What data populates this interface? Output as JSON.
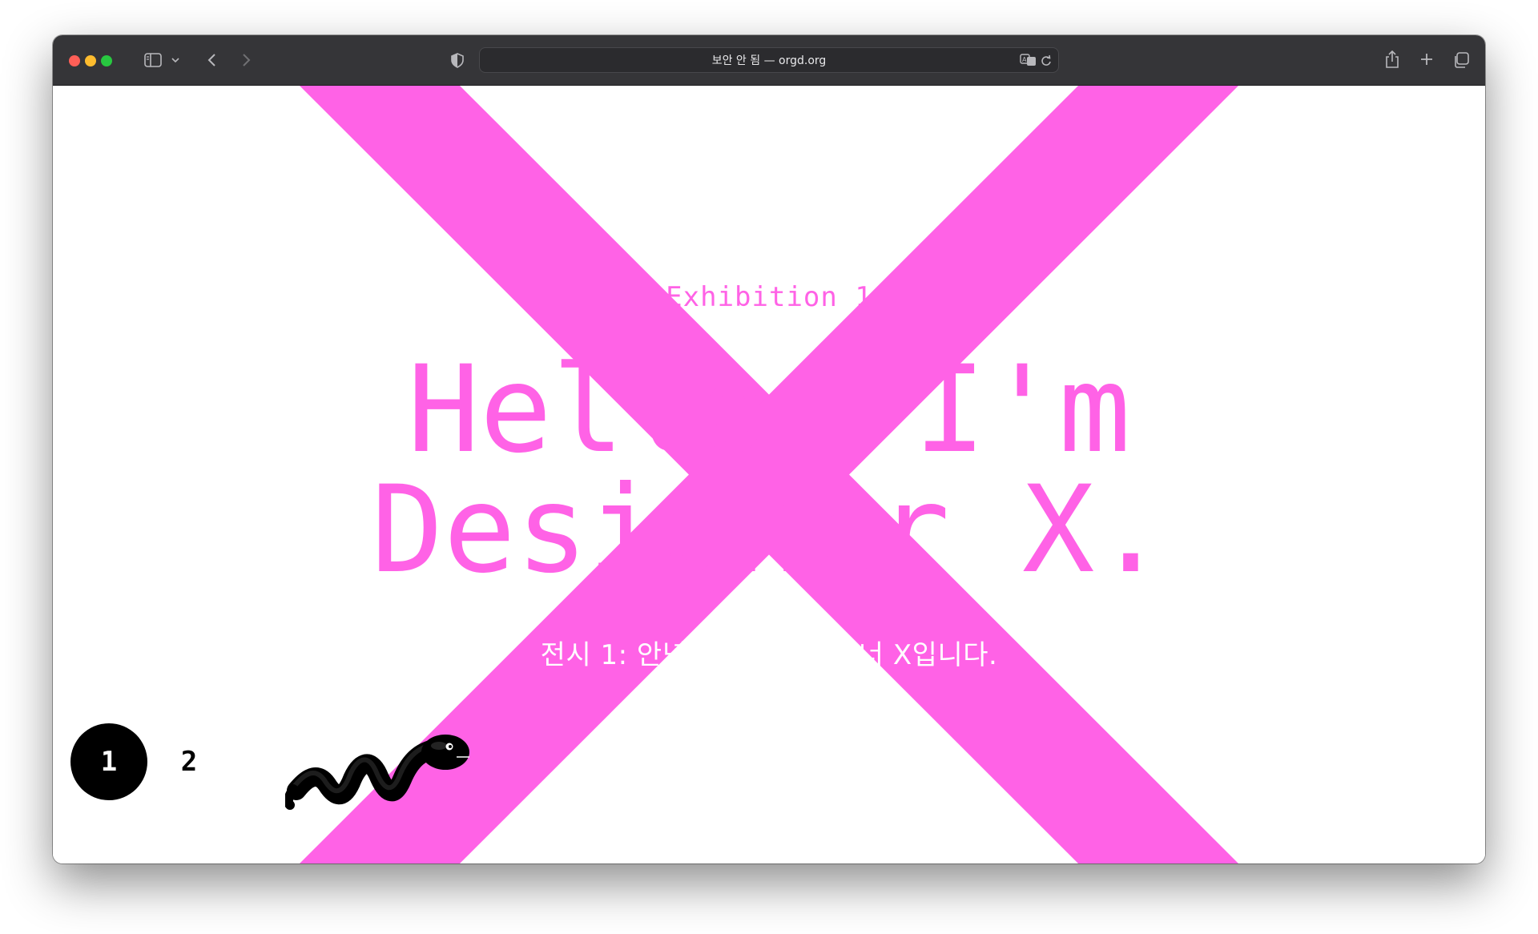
{
  "browser": {
    "url_display": "보안 안 됨 — orgd.org",
    "traffic_lights": {
      "close": "#ff5f57",
      "minimize": "#febc2e",
      "zoom": "#28c840"
    },
    "icons": [
      "sidebar-icon",
      "chevron-down-icon",
      "back-icon",
      "forward-icon",
      "shield-icon",
      "translate-icon",
      "reload-icon",
      "share-icon",
      "new-tab-icon",
      "tab-overview-icon"
    ]
  },
  "page": {
    "kicker": "Exhibition 1",
    "title_line1": "Hello, I'm",
    "title_line2": "Designer X.",
    "subtitle": "전시 1: 안녕하세요, 디자이너 X입니다.",
    "accent_color": "#ff62e6",
    "pagination": {
      "items": [
        "1",
        "2"
      ],
      "active": "1"
    },
    "mascot_icon": "snake-icon"
  }
}
